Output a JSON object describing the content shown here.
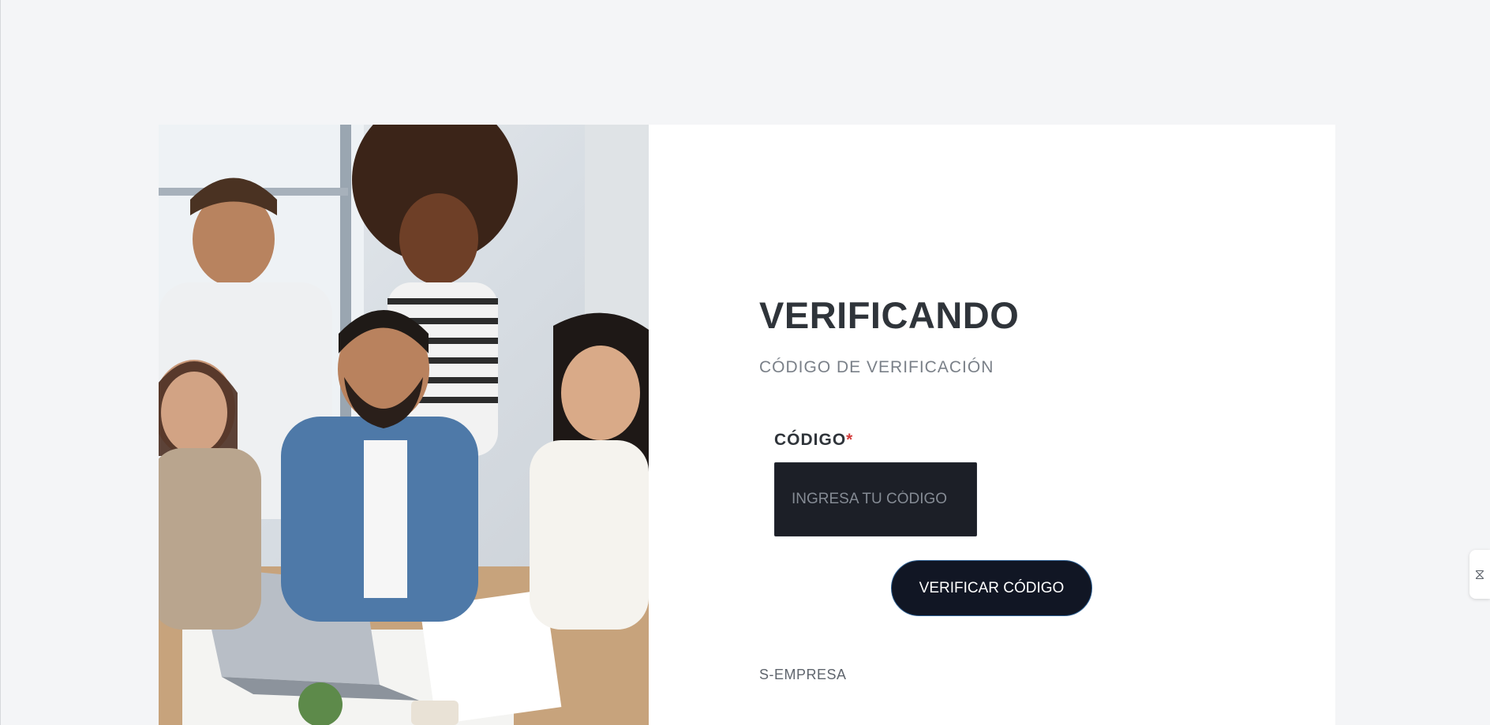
{
  "main": {
    "title": "VERIFICANDO",
    "subtitle": "CÓDIGO DE VERIFICACIÓN",
    "code_label": "CÓDIGO",
    "required_mark": "*",
    "code_placeholder": "INGRESA TU CÓDIGO",
    "code_value": "",
    "verify_button": "VERIFICAR CÓDIGO",
    "footer": "S-EMPRESA"
  },
  "hero": {
    "image_subject": "team-photo"
  },
  "side_tab": {
    "icon": "widget-handle-icon",
    "glyph": "⧖"
  },
  "colors": {
    "button_bg": "#111624",
    "input_bg": "#1c1f27",
    "required": "#d33c3c",
    "page_bg": "#f4f5f7"
  }
}
